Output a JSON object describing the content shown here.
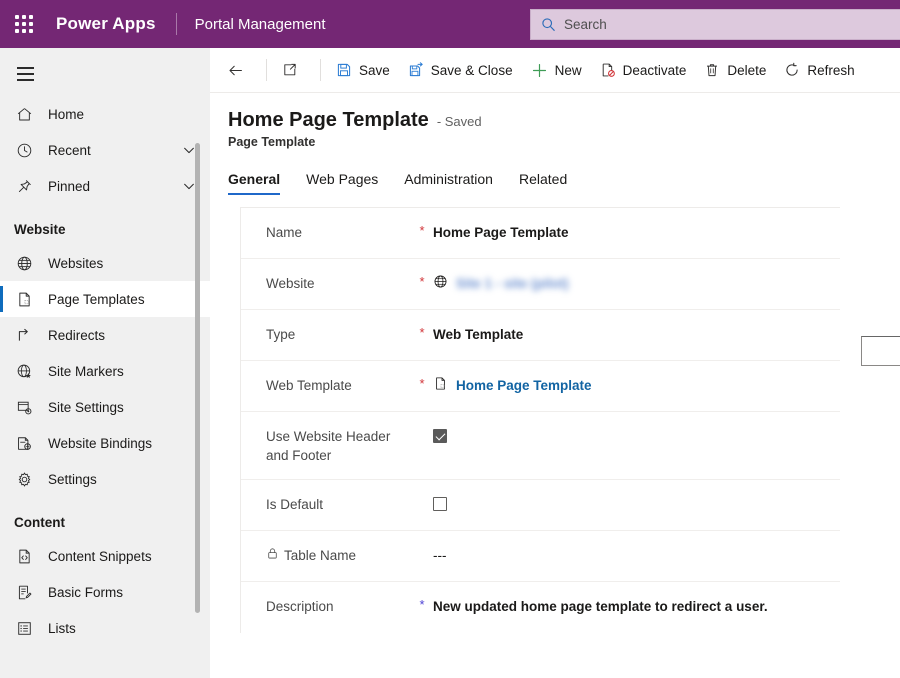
{
  "topbar": {
    "waffle_icon": "waffle-grid-icon",
    "brand": "Power Apps",
    "app_name": "Portal Management",
    "search": {
      "icon": "search-icon",
      "placeholder": "Search",
      "value": ""
    },
    "accent_color": "#742774"
  },
  "sidebar": {
    "hamburger_icon": "hamburger-menu-icon",
    "items": [
      {
        "label": "Home",
        "icon": "home-icon",
        "expandable": false,
        "selected": false
      },
      {
        "label": "Recent",
        "icon": "clock-icon",
        "expandable": true,
        "selected": false
      },
      {
        "label": "Pinned",
        "icon": "pin-icon",
        "expandable": true,
        "selected": false
      }
    ],
    "groups": [
      {
        "title": "Website",
        "items": [
          {
            "label": "Websites",
            "icon": "globe-icon",
            "selected": false
          },
          {
            "label": "Page Templates",
            "icon": "page-template-icon",
            "selected": true
          },
          {
            "label": "Redirects",
            "icon": "redirect-arrow-icon",
            "selected": false
          },
          {
            "label": "Site Markers",
            "icon": "globe-star-icon",
            "selected": false
          },
          {
            "label": "Site Settings",
            "icon": "site-settings-icon",
            "selected": false
          },
          {
            "label": "Website Bindings",
            "icon": "website-bindings-icon",
            "selected": false
          },
          {
            "label": "Settings",
            "icon": "gear-icon",
            "selected": false
          }
        ]
      },
      {
        "title": "Content",
        "items": [
          {
            "label": "Content Snippets",
            "icon": "code-file-icon",
            "selected": false
          },
          {
            "label": "Basic Forms",
            "icon": "form-edit-icon",
            "selected": false
          },
          {
            "label": "Lists",
            "icon": "list-icon",
            "selected": false
          }
        ]
      }
    ]
  },
  "commandbar": {
    "back_icon": "back-arrow-icon",
    "popout_icon": "open-in-new-window-icon",
    "commands": [
      {
        "label": "Save",
        "icon": "save-disk-icon",
        "color": "#2b7cd3"
      },
      {
        "label": "Save & Close",
        "icon": "save-and-close-icon",
        "color": "#2b7cd3"
      },
      {
        "label": "New",
        "icon": "plus-icon",
        "color": "#3f9c56"
      },
      {
        "label": "Deactivate",
        "icon": "deactivate-icon",
        "color": "#323130"
      },
      {
        "label": "Delete",
        "icon": "trash-icon",
        "color": "#323130"
      },
      {
        "label": "Refresh",
        "icon": "refresh-icon",
        "color": "#323130"
      }
    ]
  },
  "record": {
    "title": "Home Page Template",
    "status": "- Saved",
    "entity": "Page Template"
  },
  "tabs": [
    {
      "label": "General",
      "active": true
    },
    {
      "label": "Web Pages",
      "active": false
    },
    {
      "label": "Administration",
      "active": false
    },
    {
      "label": "Related",
      "active": false
    }
  ],
  "form": {
    "fields": [
      {
        "label": "Name",
        "required_mark": "*",
        "required_color": "red",
        "value": "Home Page Template",
        "kind": "text"
      },
      {
        "label": "Website",
        "required_mark": "*",
        "required_color": "red",
        "value": "Site 1 - site (pilot)",
        "kind": "lookup-redacted",
        "icon": "globe-icon"
      },
      {
        "label": "Type",
        "required_mark": "*",
        "required_color": "red",
        "value": "Web Template",
        "kind": "text"
      },
      {
        "label": "Web Template",
        "required_mark": "*",
        "required_color": "red",
        "value": "Home Page Template",
        "kind": "lookup-link",
        "icon": "file-icon"
      },
      {
        "label": "Use Website Header and Footer",
        "required_mark": "",
        "required_color": "",
        "value": "checked",
        "kind": "checkbox"
      },
      {
        "label": "Is Default",
        "required_mark": "",
        "required_color": "",
        "value": "unchecked",
        "kind": "checkbox"
      },
      {
        "label": "Table Name",
        "required_mark": "",
        "required_color": "",
        "value": "---",
        "kind": "locked-text",
        "icon": "lock-icon"
      },
      {
        "label": "Description",
        "required_mark": "*",
        "required_color": "blue",
        "value": "New updated home page template to redirect a user.",
        "kind": "text"
      }
    ],
    "side_input_value": ""
  }
}
